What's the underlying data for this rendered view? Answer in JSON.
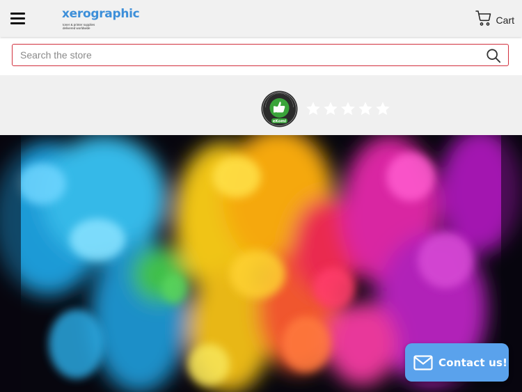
{
  "header": {
    "menu_icon": "hamburger-menu-icon",
    "logo": {
      "text": "xerographic",
      "tagline": "toner & printer supplies delivered worldwide",
      "color": "#3d8fd9"
    },
    "cart": {
      "label": "Cart",
      "icon": "shopping-cart-icon"
    }
  },
  "search": {
    "placeholder": "Search the store",
    "value": "",
    "icon": "search-icon",
    "border_color": "#d12f3d"
  },
  "ekomi": {
    "badge_text_top": "THE FEEDBACK COMPANY",
    "badge_text_bottom": "eKomi",
    "rating_stars": 5,
    "rating_value": 0
  },
  "hero": {
    "image": "colorful-smoke-explosion"
  },
  "contact": {
    "label": "Contact us!",
    "icon": "envelope-icon",
    "color": "#5aa2ec"
  }
}
